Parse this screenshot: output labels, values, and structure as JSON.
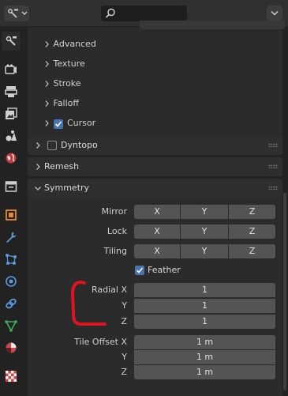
{
  "header": {
    "editor_type_icon": "tool-icon",
    "search_placeholder": "",
    "dropdown_icon": "chevron-down-icon"
  },
  "tabs": [
    {
      "icon": "tool-icon",
      "active": true
    },
    {
      "icon": "render-icon"
    },
    {
      "icon": "output-icon"
    },
    {
      "icon": "view-layer-icon"
    },
    {
      "icon": "scene-icon"
    },
    {
      "icon": "world-icon"
    },
    {
      "icon": "collection-icon"
    },
    {
      "icon": "object-icon"
    },
    {
      "icon": "modifier-wrench-icon"
    },
    {
      "icon": "particles-icon"
    },
    {
      "icon": "physics-icon"
    },
    {
      "icon": "constraints-icon"
    },
    {
      "icon": "data-icon"
    },
    {
      "icon": "material-icon"
    },
    {
      "icon": "texture-icon"
    }
  ],
  "brush_subpanels": [
    "Advanced",
    "Texture",
    "Stroke",
    "Falloff",
    "Cursor"
  ],
  "cursor_checked": true,
  "panels": {
    "dyntopo": {
      "label": "Dyntopo",
      "checked": false
    },
    "remesh": {
      "label": "Remesh"
    },
    "symmetry": {
      "label": "Symmetry"
    }
  },
  "symmetry": {
    "mirror_label": "Mirror",
    "lock_label": "Lock",
    "tiling_label": "Tiling",
    "axes": [
      "X",
      "Y",
      "Z"
    ],
    "feather_label": "Feather",
    "feather_checked": true,
    "radial_labels": [
      "Radial X",
      "Y",
      "Z"
    ],
    "radial_values": [
      "1",
      "1",
      "1"
    ],
    "tile_offset_labels": [
      "Tile Offset X",
      "Y",
      "Z"
    ],
    "tile_offset_values": [
      "1 m",
      "1 m",
      "1 m"
    ]
  },
  "colors": {
    "accent": "#4772b3",
    "annotation": "#e0141e"
  }
}
